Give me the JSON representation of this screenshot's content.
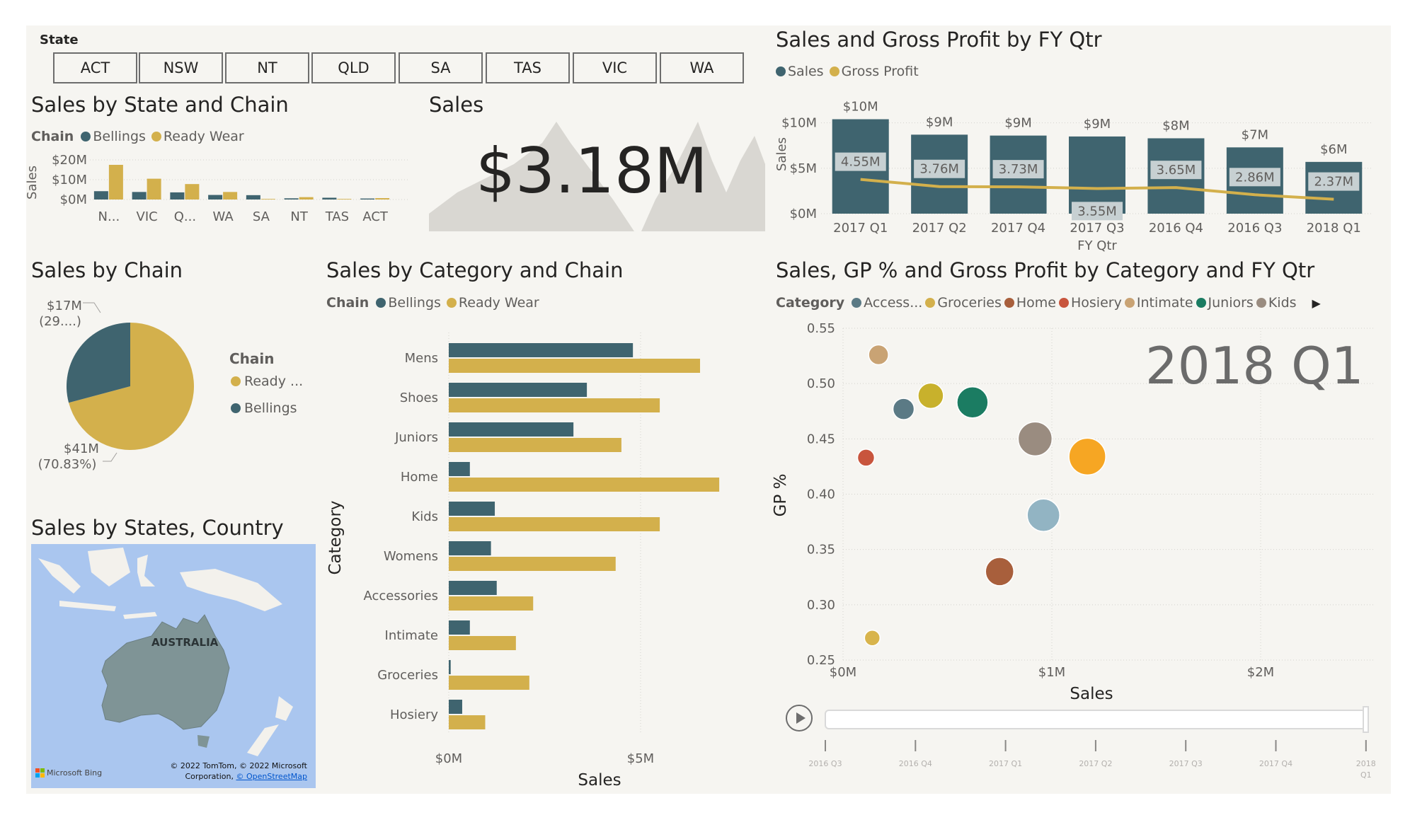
{
  "state_slicer": {
    "title": "State",
    "options": [
      "ACT",
      "NSW",
      "NT",
      "QLD",
      "SA",
      "TAS",
      "VIC",
      "WA"
    ]
  },
  "titles": {
    "state_chain": "Sales by State and Chain",
    "sales_card": "Sales",
    "fy_qtr": "Sales and Gross Profit by FY Qtr",
    "chain_pie": "Sales by Chain",
    "category_chain": "Sales by Category and Chain",
    "scatter": "Sales, GP % and Gross Profit by Category and FY Qtr",
    "map": "Sales by States, Country"
  },
  "legends": {
    "chain_label": "Chain",
    "bellings": "Bellings",
    "ready_wear": "Ready Wear",
    "ready_short": "Ready ...",
    "sales": "Sales",
    "gross_profit": "Gross Profit",
    "category_label": "Category",
    "categories_short": [
      "Access...",
      "Groceries",
      "Home",
      "Hosiery",
      "Intimate",
      "Juniors",
      "Kids"
    ]
  },
  "colors": {
    "bellings": "#3f646f",
    "ready_wear": "#d3b04c",
    "gp_bar": "#c7d0d2",
    "background": "#f6f5f1",
    "map_water": "#aac6ef",
    "map_land": "#7f9496"
  },
  "sales_card": {
    "value": "$3.18M"
  },
  "map": {
    "country_label": "AUSTRALIA",
    "bing_label": "Microsoft Bing",
    "copyright": "© 2022 TomTom, © 2022 Microsoft",
    "copyright2": "Corporation,",
    "osm_link": "© OpenStreetMap"
  },
  "scatter_play": {
    "overlay_label": "2018 Q1",
    "timeline": [
      "2016 Q3",
      "2016 Q4",
      "2017 Q1",
      "2017 Q2",
      "2017 Q3",
      "2017 Q4",
      "2018 Q1"
    ]
  },
  "chart_data": [
    {
      "id": "state_chain",
      "type": "bar",
      "ylabel": "Sales",
      "ylim": [
        0,
        20
      ],
      "ytick_labels": [
        "$0M",
        "$10M",
        "$20M"
      ],
      "categories": [
        "N...",
        "VIC",
        "Q...",
        "WA",
        "SA",
        "NT",
        "TAS",
        "ACT"
      ],
      "series": [
        {
          "name": "Bellings",
          "values": [
            4.2,
            3.8,
            3.6,
            2.3,
            2.2,
            0.6,
            0.9,
            0.5
          ]
        },
        {
          "name": "Ready Wear",
          "values": [
            17.5,
            10.5,
            7.8,
            3.8,
            0.3,
            1.2,
            0.3,
            0.7
          ]
        }
      ]
    },
    {
      "id": "fy_qtr",
      "type": "bar",
      "xlabel": "FY Qtr",
      "ylabel": "Sales",
      "ylim": [
        0,
        12
      ],
      "ytick_labels": [
        "$0M",
        "$5M",
        "$10M"
      ],
      "categories": [
        "2017 Q1",
        "2017 Q2",
        "2017 Q4",
        "2017 Q3",
        "2016 Q4",
        "2016 Q3",
        "2018 Q1"
      ],
      "series": [
        {
          "name": "Sales",
          "values": [
            10.4,
            8.7,
            8.6,
            8.5,
            8.3,
            7.3,
            5.7
          ],
          "labels": [
            "$10M",
            "$9M",
            "$9M",
            "$9M",
            "$8M",
            "$7M",
            "$6M"
          ]
        },
        {
          "name": "Gross Profit",
          "values": [
            4.55,
            3.76,
            3.73,
            3.55,
            3.65,
            2.86,
            2.37
          ],
          "labels": [
            "4.55M",
            "3.76M",
            "3.73M",
            "3.55M",
            "3.65M",
            "2.86M",
            "2.37M"
          ]
        }
      ]
    },
    {
      "id": "chain_pie",
      "type": "pie",
      "slices": [
        {
          "name": "Bellings",
          "value": 29.17,
          "label_line1": "$17M",
          "label_line2": "(29....)"
        },
        {
          "name": "Ready ...",
          "value": 70.83,
          "label_line1": "$41M",
          "label_line2": "(70.83%)"
        }
      ]
    },
    {
      "id": "category_chain",
      "type": "bar",
      "orientation": "horizontal",
      "xlabel": "Sales",
      "ylabel": "Category",
      "xlim": [
        0,
        7.5
      ],
      "xtick_labels": [
        "$0M",
        "$5M"
      ],
      "categories": [
        "Mens",
        "Shoes",
        "Juniors",
        "Home",
        "Kids",
        "Womens",
        "Accessories",
        "Intimate",
        "Groceries",
        "Hosiery"
      ],
      "series": [
        {
          "name": "Bellings",
          "values": [
            4.8,
            3.6,
            3.25,
            0.55,
            1.2,
            1.1,
            1.25,
            0.55,
            0.05,
            0.35
          ]
        },
        {
          "name": "Ready Wear",
          "values": [
            6.55,
            5.5,
            4.5,
            7.05,
            5.5,
            4.35,
            2.2,
            1.75,
            2.1,
            0.95
          ]
        }
      ]
    },
    {
      "id": "scatter",
      "type": "scatter",
      "xlabel": "Sales",
      "ylabel": "GP %",
      "xlim": [
        0,
        2.5
      ],
      "ylim": [
        0.25,
        0.55
      ],
      "xtick_labels": [
        "$0M",
        "$1M",
        "$2M"
      ],
      "ytick_labels": [
        "0.25",
        "0.30",
        "0.35",
        "0.40",
        "0.45",
        "0.50",
        "0.55"
      ],
      "points": [
        {
          "name": "Intimate",
          "x": 0.17,
          "y": 0.526,
          "size": 14,
          "color": "#c9a374"
        },
        {
          "name": "Groceries",
          "x": 0.42,
          "y": 0.489,
          "size": 18,
          "color": "#c8b12c"
        },
        {
          "name": "Accessories",
          "x": 0.29,
          "y": 0.477,
          "size": 15,
          "color": "#5b7a85"
        },
        {
          "name": "Juniors",
          "x": 0.62,
          "y": 0.483,
          "size": 22,
          "color": "#1b7c62"
        },
        {
          "name": "Kids",
          "x": 0.92,
          "y": 0.45,
          "size": 24,
          "color": "#9a8c80"
        },
        {
          "name": "Womens",
          "x": 1.17,
          "y": 0.434,
          "size": 26,
          "color": "#f6a623"
        },
        {
          "name": "Hosiery",
          "x": 0.11,
          "y": 0.433,
          "size": 12,
          "color": "#c8553d"
        },
        {
          "name": "Shoes",
          "x": 0.96,
          "y": 0.381,
          "size": 23,
          "color": "#92b4c3"
        },
        {
          "name": "Home",
          "x": 0.75,
          "y": 0.33,
          "size": 20,
          "color": "#a85f3c"
        },
        {
          "name": "Mens",
          "x": 0.14,
          "y": 0.27,
          "size": 11,
          "color": "#d8b44c"
        }
      ]
    }
  ]
}
